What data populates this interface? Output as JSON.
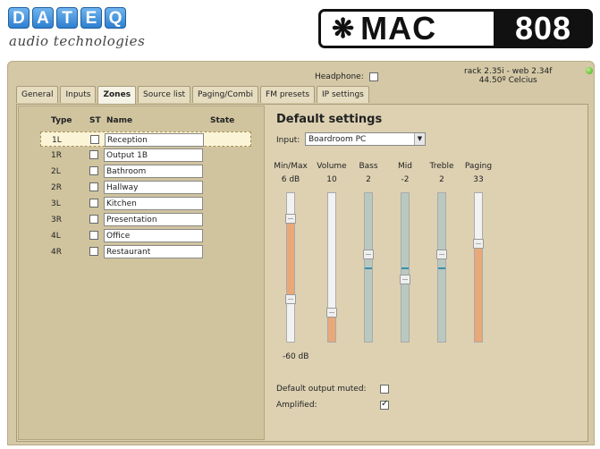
{
  "brand": {
    "letters": [
      "D",
      "A",
      "T",
      "E",
      "Q"
    ],
    "subtitle": "audio technologies",
    "product_glyph": "❋",
    "product_mac": "MAC",
    "product_num": "808"
  },
  "topbar": {
    "headphone_label": "Headphone:",
    "headphone_checked": false,
    "version_line1": "rack 2.35i - web 2.34f",
    "version_line2": "44.50º Celcius",
    "status_color": "#45a81a"
  },
  "tabs": [
    {
      "label": "General",
      "active": false
    },
    {
      "label": "Inputs",
      "active": false
    },
    {
      "label": "Zones",
      "active": true
    },
    {
      "label": "Source list",
      "active": false
    },
    {
      "label": "Paging/Combi",
      "active": false
    },
    {
      "label": "FM presets",
      "active": false
    },
    {
      "label": "IP settings",
      "active": false
    }
  ],
  "zones": {
    "headers": {
      "type": "Type",
      "st": "ST",
      "name": "Name",
      "state": "State"
    },
    "rows": [
      {
        "type": "1L",
        "st": false,
        "name": "Reception",
        "selected": true
      },
      {
        "type": "1R",
        "st": false,
        "name": "Output 1B",
        "selected": false
      },
      {
        "type": "2L",
        "st": false,
        "name": "Bathroom",
        "selected": false
      },
      {
        "type": "2R",
        "st": false,
        "name": "Hallway",
        "selected": false
      },
      {
        "type": "3L",
        "st": false,
        "name": "Kitchen",
        "selected": false
      },
      {
        "type": "3R",
        "st": false,
        "name": "Presentation",
        "selected": false
      },
      {
        "type": "4L",
        "st": false,
        "name": "Office",
        "selected": false
      },
      {
        "type": "4R",
        "st": false,
        "name": "Restaurant",
        "selected": false
      }
    ]
  },
  "default_settings": {
    "title": "Default settings",
    "input_label": "Input:",
    "input_value": "Boardroom PC",
    "minmax_low": "-60 dB",
    "sliders": [
      {
        "key": "minmax",
        "label": "Min/Max",
        "value": "6 dB",
        "type": "range",
        "high": 0.83,
        "low": 0.29,
        "fill_color": "#e8a878"
      },
      {
        "key": "volume",
        "label": "Volume",
        "value": "10",
        "type": "level",
        "level": 0.2,
        "fill_color": "#e8a878"
      },
      {
        "key": "bass",
        "label": "Bass",
        "value": "2",
        "type": "tone",
        "level": 0.59,
        "fill_color": "#b9c9c0"
      },
      {
        "key": "mid",
        "label": "Mid",
        "value": "-2",
        "type": "tone",
        "level": 0.42,
        "fill_color": "#b9c9c0"
      },
      {
        "key": "treble",
        "label": "Treble",
        "value": "2",
        "type": "tone",
        "level": 0.59,
        "fill_color": "#b9c9c0"
      },
      {
        "key": "paging",
        "label": "Paging",
        "value": "33",
        "type": "level",
        "level": 0.66,
        "fill_color": "#e8a878"
      }
    ],
    "muted_label": "Default output muted:",
    "muted_checked": false,
    "amplified_label": "Amplified:",
    "amplified_checked": true
  }
}
